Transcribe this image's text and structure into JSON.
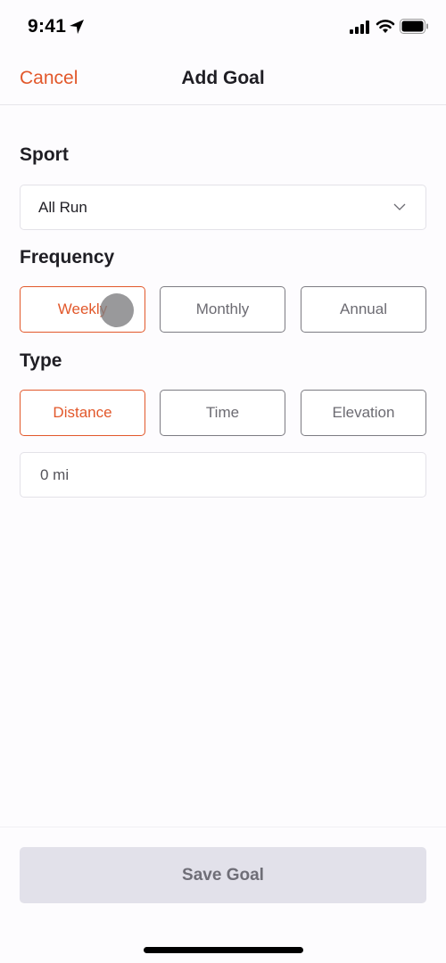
{
  "status_bar": {
    "time": "9:41",
    "icons": [
      "location-arrow-icon",
      "cellular-signal-icon",
      "wifi-icon",
      "battery-icon"
    ]
  },
  "nav": {
    "cancel_label": "Cancel",
    "title": "Add Goal"
  },
  "sport": {
    "label": "Sport",
    "selected_value": "All Run",
    "icon": "chevron-down-icon"
  },
  "frequency": {
    "label": "Frequency",
    "options": [
      {
        "label": "Weekly",
        "selected": true
      },
      {
        "label": "Monthly",
        "selected": false
      },
      {
        "label": "Annual",
        "selected": false
      }
    ]
  },
  "type": {
    "label": "Type",
    "options": [
      {
        "label": "Distance",
        "selected": true
      },
      {
        "label": "Time",
        "selected": false
      },
      {
        "label": "Elevation",
        "selected": false
      }
    ]
  },
  "goal_input": {
    "value": "0 mi"
  },
  "footer": {
    "save_label": "Save Goal"
  },
  "colors": {
    "accent": "#e2582b",
    "text_primary": "#1f1e24",
    "segment_inactive": "#7c7b82",
    "button_disabled_bg": "#e2e1ea",
    "button_disabled_text": "#6f6e77"
  }
}
